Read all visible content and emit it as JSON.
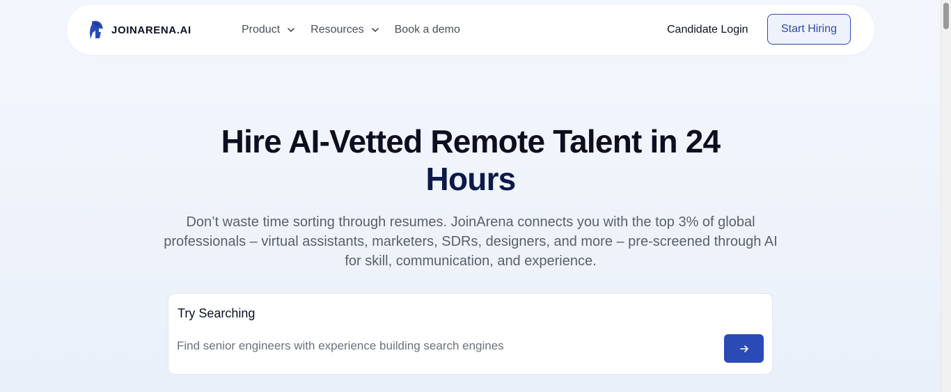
{
  "brand": {
    "name": "JOINARENA.AI",
    "logo_icon": "spartan-helmet-icon",
    "accent": "#2f4aa8"
  },
  "nav": {
    "items": [
      {
        "label": "Product",
        "has_dropdown": true
      },
      {
        "label": "Resources",
        "has_dropdown": true
      },
      {
        "label": "Book a demo",
        "has_dropdown": false
      }
    ],
    "login_label": "Candidate Login",
    "cta_label": "Start Hiring"
  },
  "hero": {
    "title_line1": "Hire AI-Vetted Remote Talent in 24",
    "title_line2": "Hours",
    "subtitle": "Don’t waste time sorting through resumes. JoinArena connects you with the top 3% of global professionals – virtual assistants, marketers, SDRs, designers, and more – pre-screened through AI for skill, communication, and experience."
  },
  "search": {
    "label": "Try Searching",
    "placeholder": "Find senior engineers with experience building search engines",
    "submit_icon": "arrow-right-icon",
    "button_color": "#2a4bb5"
  }
}
